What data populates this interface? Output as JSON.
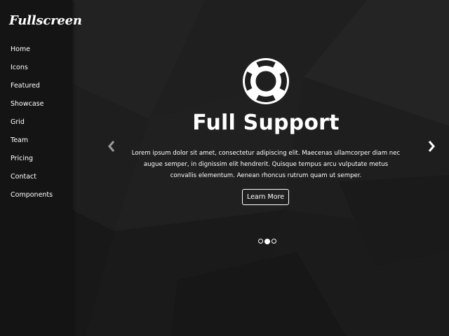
{
  "sidebar": {
    "brand": "Fullscreen",
    "items": [
      {
        "label": "Home"
      },
      {
        "label": "Icons"
      },
      {
        "label": "Featured"
      },
      {
        "label": "Showcase"
      },
      {
        "label": "Grid"
      },
      {
        "label": "Team"
      },
      {
        "label": "Pricing"
      },
      {
        "label": "Contact"
      },
      {
        "label": "Components"
      }
    ]
  },
  "slide": {
    "icon": "life-ring-icon",
    "title": "Full Support",
    "text": "Lorem ipsum dolor sit amet, consectetur adipiscing elit. Maecenas ullamcorper diam nec augue semper, in dignissim elit hendrerit. Quisque tempus arcu vulputate metus convallis elementum. Aenean rhoncus rutrum quam ut semper.",
    "button_label": "Learn More"
  },
  "carousel": {
    "slide_count": 3,
    "active_slide": 2
  },
  "colors": {
    "background": "#1d1d1d",
    "sidebar": "#141414",
    "text": "#ffffff",
    "arrow": "#9a9a9a"
  }
}
